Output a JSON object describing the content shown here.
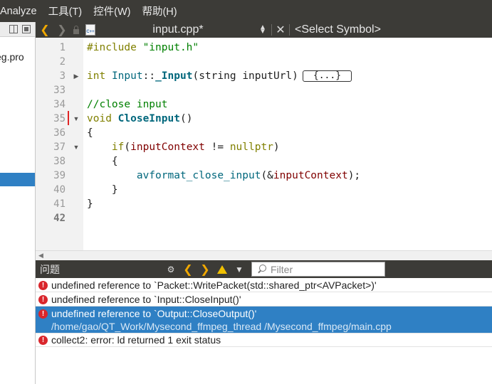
{
  "menubar": {
    "items": [
      "Analyze",
      "工具(T)",
      "控件(W)",
      "帮助(H)"
    ]
  },
  "sidebar": {
    "file_label": "eg.pro"
  },
  "editor_toolbar": {
    "file_name": "input.cpp*",
    "symbol_placeholder": "<Select Symbol>",
    "file_icon_text": "C++"
  },
  "editor": {
    "line_numbers": [
      "1",
      "2",
      "3",
      "33",
      "34",
      "35",
      "36",
      "37",
      "38",
      "39",
      "40",
      "41",
      "42"
    ],
    "current_line": "42",
    "lines": {
      "l1_directive": "#include",
      "l1_file": "\"input.h\"",
      "l3_type": "int",
      "l3_class": "Input",
      "l3_scope": "::",
      "l3_func": "_Input",
      "l3_open": "(",
      "l3_param_type": "string",
      "l3_param": "inputUrl",
      "l3_close": ")",
      "l3_folded": "{...}",
      "l34_comment": "//close input",
      "l35_type": "void",
      "l35_func": "CloseInput",
      "l35_parens": "()",
      "l36": "{",
      "l37_kw": "if",
      "l37_open": "(",
      "l37_var": "inputContext",
      "l37_op": " != ",
      "l37_null": "nullptr",
      "l37_close": ")",
      "l38": "{",
      "l39_func": "avformat_close_input",
      "l39_open": "(&",
      "l39_var": "inputContext",
      "l39_close": ");",
      "l40": "}",
      "l41": "}"
    }
  },
  "issues": {
    "title": "问题",
    "filter_placeholder": "Filter",
    "items": [
      {
        "message": "undefined reference to `Packet::WritePacket(std::shared_ptr<AVPacket>)'"
      },
      {
        "message": "undefined reference to `Input::CloseInput()'"
      },
      {
        "message": "undefined reference to `Output::CloseOutput()'",
        "path": "/home/gao/QT_Work/Mysecond_ffmpeg_thread /Mysecond_ffmpeg/main.cpp",
        "selected": true
      },
      {
        "message": "collect2: error: ld returned 1 exit status"
      }
    ]
  },
  "colors": {
    "accent": "#2f80c4",
    "error": "#d9262c",
    "toolbar": "#3c3b37",
    "nav_arrow": "#f0a800"
  }
}
